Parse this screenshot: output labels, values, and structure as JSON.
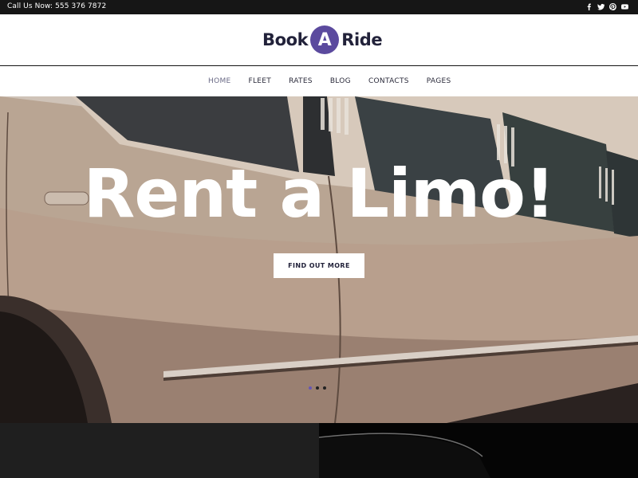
{
  "topbar": {
    "phone": "Call Us Now: 555 376 7872",
    "social": [
      "facebook-icon",
      "twitter-icon",
      "pinterest-icon",
      "youtube-icon"
    ]
  },
  "header": {
    "logo_left": "Book",
    "logo_mark": "A",
    "logo_right": "Ride",
    "accent": "#5b4a9e"
  },
  "nav": {
    "items": [
      {
        "label": "HOME"
      },
      {
        "label": "FLEET"
      },
      {
        "label": "RATES"
      },
      {
        "label": "BLOG"
      },
      {
        "label": "CONTACTS"
      },
      {
        "label": "PAGES"
      }
    ],
    "active_index": 0
  },
  "hero": {
    "title": "Rent a Limo!",
    "cta_label": "FIND OUT MORE",
    "slides": 3,
    "active_slide": 1
  }
}
